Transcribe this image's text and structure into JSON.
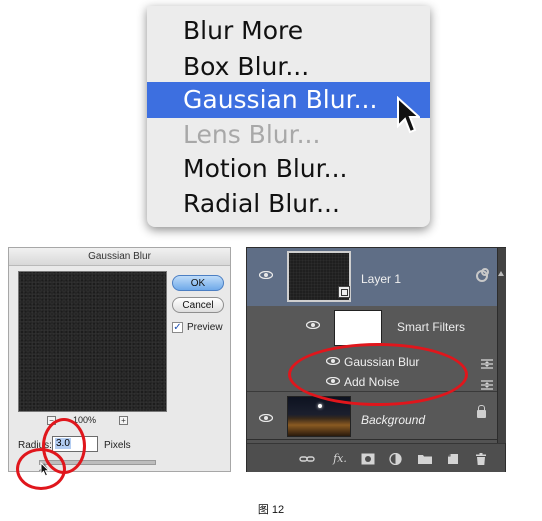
{
  "menu": {
    "items": [
      {
        "label": "Blur More",
        "state": "normal"
      },
      {
        "label": "Box Blur...",
        "state": "normal"
      },
      {
        "label": "Gaussian Blur...",
        "state": "selected"
      },
      {
        "label": "Lens Blur...",
        "state": "disabled"
      },
      {
        "label": "Motion Blur...",
        "state": "normal"
      },
      {
        "label": "Radial Blur...",
        "state": "normal"
      }
    ],
    "selected_color": "#3d6fe0"
  },
  "dialog": {
    "title": "Gaussian Blur",
    "ok_label": "OK",
    "cancel_label": "Cancel",
    "preview_label": "Preview",
    "preview_checked": true,
    "zoom_out": "−",
    "zoom_in": "+",
    "zoom_value": "100%",
    "radius_label": "Radius:",
    "radius_value": "3.0",
    "pixels_label": "Pixels"
  },
  "layers": {
    "layer1_name": "Layer 1",
    "smart_filters_label": "Smart Filters",
    "filter_1": "Gaussian Blur",
    "filter_2": "Add Noise",
    "background_name": "Background",
    "footer_icons": [
      "link-icon",
      "fx-icon",
      "mask-icon",
      "adjustment-icon",
      "folder-icon",
      "new-layer-icon",
      "trash-icon"
    ],
    "fx_label": "fx."
  },
  "annotation_color": "#e0161c",
  "caption": "图 12"
}
